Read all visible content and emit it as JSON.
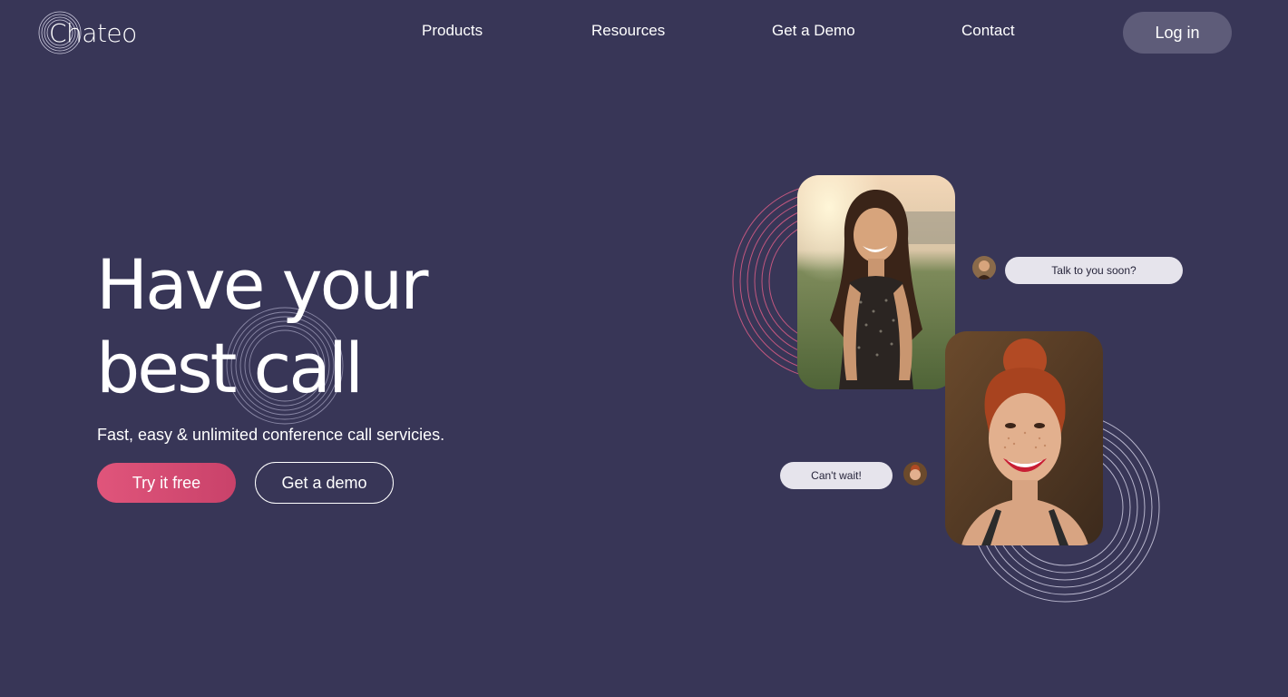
{
  "header": {
    "logo_text": "Chateo",
    "nav": [
      {
        "label": "Products"
      },
      {
        "label": "Resources"
      },
      {
        "label": "Get a Demo"
      },
      {
        "label": "Contact"
      }
    ],
    "login_label": "Log in"
  },
  "hero": {
    "title_line1": "Have your",
    "title_line2": "best call",
    "subtitle": "Fast, easy & unlimited conference call servicies.",
    "primary_cta": "Try it free",
    "secondary_cta": "Get a demo"
  },
  "chat": {
    "message_1": "Talk to you soon?",
    "message_2": "Can't wait!"
  },
  "colors": {
    "background": "#383657",
    "accent_pink": "#d84c73",
    "login_bg": "#5e5c79",
    "bubble_bg": "#e6e4ec"
  }
}
